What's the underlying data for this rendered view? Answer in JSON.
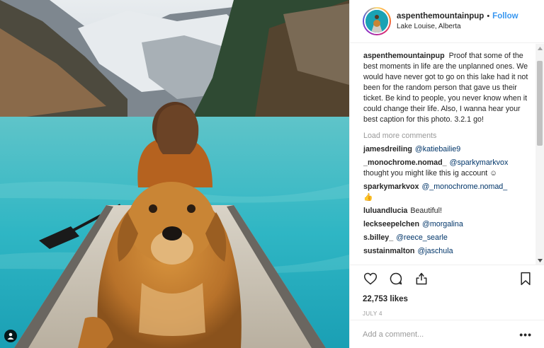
{
  "header": {
    "username": "aspenthemountainpup",
    "separator": "•",
    "follow_label": "Follow",
    "location": "Lake Louise, Alberta"
  },
  "caption": {
    "username": "aspenthemountainpup",
    "text": "Proof that some of the best moments in life are the unplanned ones. We would have never got to go on this lake had it not been for the random person that gave us their ticket. Be kind to people, you never know when it could change their life. Also, I wanna hear your best caption for this photo. 3.2.1 go!"
  },
  "load_more_label": "Load more comments",
  "comments": [
    {
      "user": "jamesdreiling",
      "mention": "@katiebailie9",
      "text": ""
    },
    {
      "user": "_monochrome.nomad_",
      "mention": "@sparkymarkvox",
      "text": "thought you might like this ig account ☺"
    },
    {
      "user": "sparkymarkvox",
      "mention": "@_monochrome.nomad_",
      "text": "👍"
    },
    {
      "user": "luluandlucia",
      "mention": "",
      "text": "Beautiful!"
    },
    {
      "user": "leckseepelchen",
      "mention": "@morgalina",
      "text": ""
    },
    {
      "user": "s.billey_",
      "mention": "@reece_searle",
      "text": ""
    },
    {
      "user": "sustainmalton",
      "mention": "@jaschula",
      "text": ""
    }
  ],
  "actions": {
    "like_icon": "heart-icon",
    "comment_icon": "comment-icon",
    "share_icon": "share-icon",
    "save_icon": "bookmark-icon"
  },
  "likes": "22,753 likes",
  "date": "JULY 4",
  "add_comment": {
    "placeholder": "Add a comment...",
    "more_label": "•••"
  },
  "colors": {
    "follow": "#3897f0",
    "text": "#262626",
    "muted": "#999999",
    "mention": "#003569",
    "lake": "#2fb3c0"
  }
}
